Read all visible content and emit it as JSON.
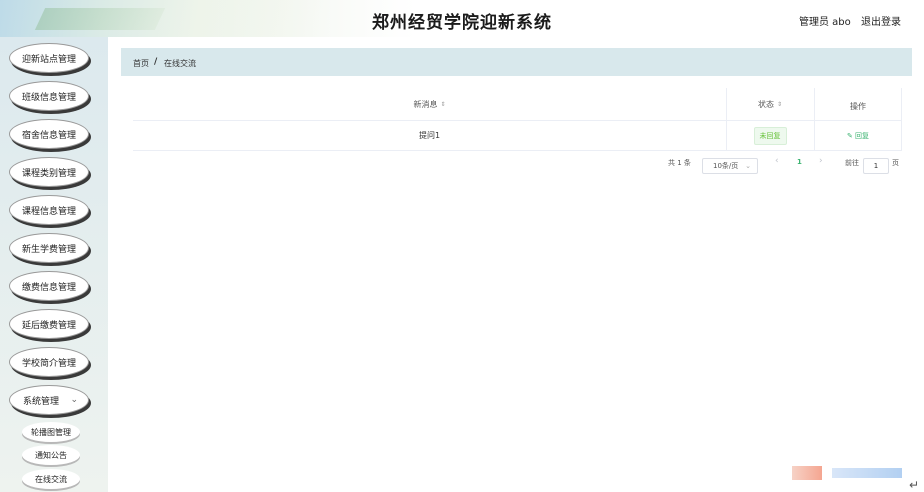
{
  "header": {
    "title": "郑州经贸学院迎新系统",
    "user": "管理员 abo",
    "logout": "退出登录"
  },
  "sidebar": {
    "items": [
      {
        "label": "迎新站点管理"
      },
      {
        "label": "班级信息管理"
      },
      {
        "label": "宿舍信息管理"
      },
      {
        "label": "课程类别管理"
      },
      {
        "label": "课程信息管理"
      },
      {
        "label": "新生学费管理"
      },
      {
        "label": "缴费信息管理"
      },
      {
        "label": "延后缴费管理"
      },
      {
        "label": "学校简介管理"
      },
      {
        "label": "系统管理"
      }
    ],
    "sub_items": [
      {
        "label": "轮播图管理"
      },
      {
        "label": "通知公告"
      },
      {
        "label": "在线交流"
      }
    ]
  },
  "breadcrumb": {
    "home": "首页",
    "separator": "/",
    "current": "在线交流"
  },
  "table": {
    "columns": [
      "新消息",
      "状态",
      "操作"
    ],
    "rows": [
      {
        "message": "提问1",
        "status": "未回复",
        "action": "回复"
      }
    ]
  },
  "pagination": {
    "total": "共 1 条",
    "page_size": "10条/页",
    "current_page": "1",
    "goto_label": "前往",
    "goto_value": "1",
    "page_unit": "页"
  },
  "colors": {
    "accent": "#3cb371",
    "status_tag": "#67c23a",
    "breadcrumb_bg": "#d8e8ec",
    "active_page": "#3cb371"
  }
}
